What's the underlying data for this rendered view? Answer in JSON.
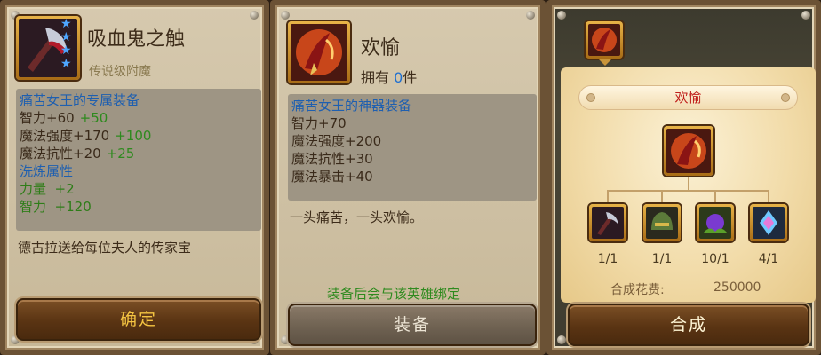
{
  "panel1": {
    "item_name": "吸血鬼之触",
    "item_icon": "vampire-scythe-icon",
    "stars": 4,
    "rarity": "传说级附魔",
    "stats_header": "痛苦女王的专属装备",
    "stats": [
      {
        "label": "智力+60",
        "bonus": "+50"
      },
      {
        "label": "魔法强度+170",
        "bonus": "+100"
      },
      {
        "label": "魔法抗性+20",
        "bonus": "+25"
      }
    ],
    "refine_header": "洗炼属性",
    "refine": [
      "力量  +2",
      "智力  +120"
    ],
    "description": "德古拉送给每位夫人的传家宝",
    "confirm_label": "确定"
  },
  "panel2": {
    "item_name": "欢愉",
    "item_icon": "flaming-blade-icon",
    "owned_prefix": "拥有",
    "owned_count": "0",
    "owned_suffix": "件",
    "stats_header": "痛苦女王的神器装备",
    "stats": [
      "智力+70",
      "魔法强度+200",
      "魔法抗性+30",
      "魔法暴击+40"
    ],
    "description": "一头痛苦，一头欢愉。",
    "bind_note": "装备后会与该英雄绑定",
    "equip_label": "装备"
  },
  "panel3": {
    "tab_icon": "flaming-blade-icon",
    "item_name": "欢愉",
    "result_icon": "flaming-blade-icon",
    "components": [
      {
        "icon": "vampire-scythe-icon",
        "count": "1/1"
      },
      {
        "icon": "green-helmet-icon",
        "count": "1/1"
      },
      {
        "icon": "nature-orb-icon",
        "count": "10/1"
      },
      {
        "icon": "crystal-shell-icon",
        "count": "4/1"
      }
    ],
    "cost_label": "合成花费:",
    "cost_value": "250000",
    "combine_label": "合成"
  }
}
